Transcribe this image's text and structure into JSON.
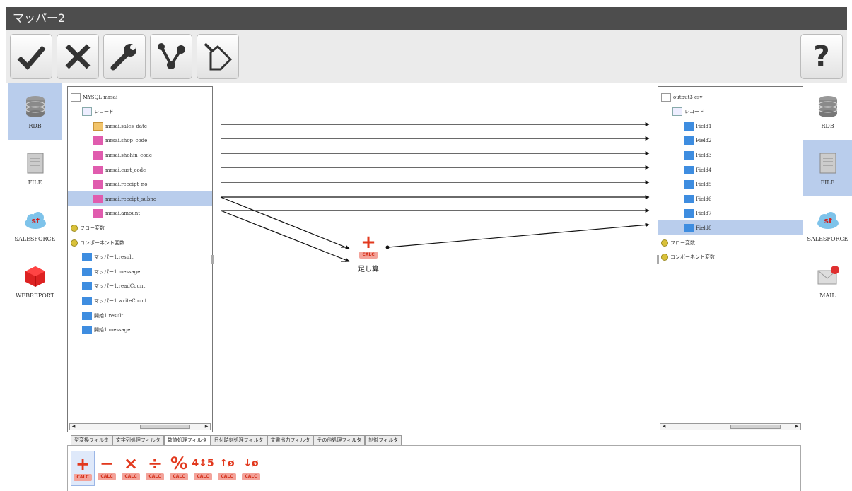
{
  "window": {
    "title": "マッパー2"
  },
  "toolbar": {
    "buttons": [
      {
        "name": "ok-check-icon"
      },
      {
        "name": "cancel-x-icon"
      },
      {
        "name": "wrench-icon"
      },
      {
        "name": "branch-nodes-icon"
      },
      {
        "name": "clear-eraser-icon"
      }
    ],
    "help": {
      "name": "help-question-icon",
      "label": "?"
    }
  },
  "left_palette": [
    {
      "label": "RDB",
      "icon": "database-icon",
      "selected": true
    },
    {
      "label": "FILE",
      "icon": "file-icon",
      "selected": false
    },
    {
      "label": "SALESFORCE",
      "icon": "salesforce-icon",
      "selected": false
    },
    {
      "label": "WEBREPORT",
      "icon": "cube-icon",
      "selected": false
    }
  ],
  "right_palette": [
    {
      "label": "RDB",
      "icon": "database-icon",
      "selected": false
    },
    {
      "label": "FILE",
      "icon": "file-icon",
      "selected": true
    },
    {
      "label": "SALESFORCE",
      "icon": "salesforce-icon",
      "selected": false
    },
    {
      "label": "MAIL",
      "icon": "mail-icon",
      "selected": false
    }
  ],
  "left_tree": [
    {
      "label": "MYSQL mrsai",
      "icon": "db",
      "level": 0
    },
    {
      "label": "レコード",
      "icon": "rec",
      "level": 1
    },
    {
      "label": "mrsai.sales_date",
      "icon": "ora",
      "level": 2
    },
    {
      "label": "mrsai.shop_code",
      "icon": "pnk",
      "level": 2
    },
    {
      "label": "mrsai.shohin_code",
      "icon": "pnk",
      "level": 2
    },
    {
      "label": "mrsai.cust_code",
      "icon": "pnk",
      "level": 2
    },
    {
      "label": "mrsai.receipt_no",
      "icon": "pnk",
      "level": 2
    },
    {
      "label": "mrsai.receipt_subno",
      "icon": "pnk",
      "level": 2,
      "selected": true
    },
    {
      "label": "mrsai.amount",
      "icon": "pnk",
      "level": 2
    },
    {
      "label": "フロー変数",
      "icon": "var",
      "level": 0
    },
    {
      "label": "コンポーネント変数",
      "icon": "var",
      "level": 0
    },
    {
      "label": "マッパー1.result",
      "icon": "blu",
      "level": 1
    },
    {
      "label": "マッパー1.message",
      "icon": "blu",
      "level": 1
    },
    {
      "label": "マッパー1.readCount",
      "icon": "blu",
      "level": 1
    },
    {
      "label": "マッパー1.writeCount",
      "icon": "blu",
      "level": 1
    },
    {
      "label": "開始1.result",
      "icon": "blu",
      "level": 1
    },
    {
      "label": "開始1.message",
      "icon": "blu",
      "level": 1
    }
  ],
  "right_tree": [
    {
      "label": "output3 csv",
      "icon": "db",
      "level": 0
    },
    {
      "label": "レコード",
      "icon": "rec",
      "level": 1
    },
    {
      "label": "Field1",
      "icon": "blu",
      "level": 2
    },
    {
      "label": "Field2",
      "icon": "blu",
      "level": 2
    },
    {
      "label": "Field3",
      "icon": "blu",
      "level": 2
    },
    {
      "label": "Field4",
      "icon": "blu",
      "level": 2
    },
    {
      "label": "Field5",
      "icon": "blu",
      "level": 2
    },
    {
      "label": "Field6",
      "icon": "blu",
      "level": 2
    },
    {
      "label": "Field7",
      "icon": "blu",
      "level": 2
    },
    {
      "label": "Field8",
      "icon": "blu",
      "level": 2,
      "selected": true
    },
    {
      "label": "フロー変数",
      "icon": "var",
      "level": 0
    },
    {
      "label": "コンポーネント変数",
      "icon": "var",
      "level": 0
    }
  ],
  "calc_node": {
    "symbol": "+",
    "tag": "CALC",
    "label": "足し算"
  },
  "filter_tabs": [
    {
      "label": "型変換フィルタ",
      "active": false
    },
    {
      "label": "文字列処理フィルタ",
      "active": false
    },
    {
      "label": "数値処理フィルタ",
      "active": true
    },
    {
      "label": "日付時刻処理フィルタ",
      "active": false
    },
    {
      "label": "文書出力フィルタ",
      "active": false
    },
    {
      "label": "その他処理フィルタ",
      "active": false
    },
    {
      "label": "制御フィルタ",
      "active": false
    }
  ],
  "filters": [
    {
      "symbol": "+",
      "tag": "CALC",
      "name": "add",
      "selected": true
    },
    {
      "symbol": "−",
      "tag": "CALC",
      "name": "subtract"
    },
    {
      "symbol": "×",
      "tag": "CALC",
      "name": "multiply"
    },
    {
      "symbol": "÷",
      "tag": "CALC",
      "name": "divide"
    },
    {
      "symbol": "%",
      "tag": "CALC",
      "name": "modulo"
    },
    {
      "symbol": "4↕5",
      "tag": "CALC",
      "name": "round"
    },
    {
      "symbol": "↑ø",
      "tag": "CALC",
      "name": "ceiling"
    },
    {
      "symbol": "↓ø",
      "tag": "CALC",
      "name": "floor"
    }
  ],
  "colors": {
    "accent_red": "#e2391e",
    "selection_blue": "#b9cdec",
    "title_bar": "#4d4d4d"
  }
}
